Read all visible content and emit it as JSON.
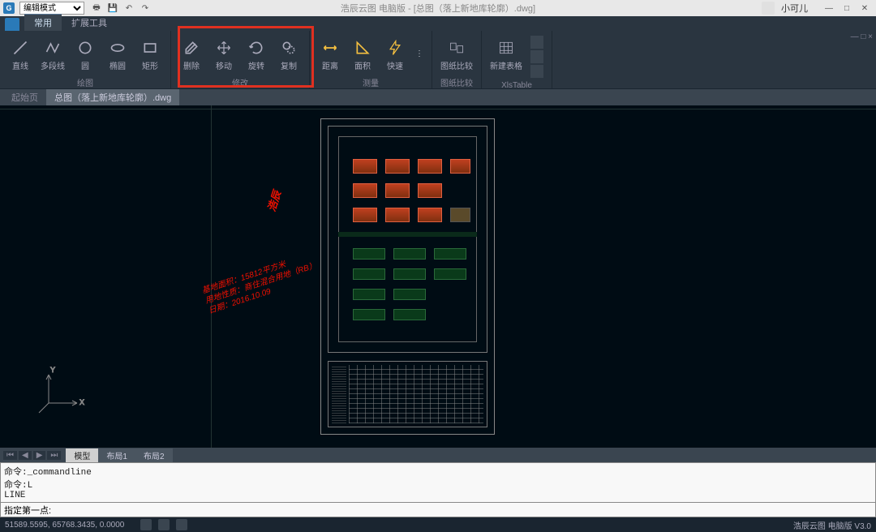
{
  "titlebar": {
    "mode": "编辑模式",
    "title": "浩辰云图 电脑版 - [总图（落上新地库轮廓）.dwg]",
    "user": "小可儿"
  },
  "menu": {
    "tabs": [
      "常用",
      "扩展工具"
    ],
    "active": 0
  },
  "ribbon": {
    "groups": [
      {
        "label": "绘图",
        "items": [
          {
            "name": "line",
            "label": "直线"
          },
          {
            "name": "polyline",
            "label": "多段线"
          },
          {
            "name": "circle",
            "label": "圆"
          },
          {
            "name": "ellipse",
            "label": "椭圆"
          },
          {
            "name": "rect",
            "label": "矩形"
          }
        ]
      },
      {
        "label": "修改",
        "items": [
          {
            "name": "erase",
            "label": "删除"
          },
          {
            "name": "move",
            "label": "移动"
          },
          {
            "name": "rotate",
            "label": "旋转"
          },
          {
            "name": "copy",
            "label": "复制"
          }
        ]
      },
      {
        "label": "测量",
        "items": [
          {
            "name": "dist",
            "label": "距离"
          },
          {
            "name": "area",
            "label": "面积"
          },
          {
            "name": "quick",
            "label": "快速"
          }
        ]
      },
      {
        "label": "图纸比较",
        "items": [
          {
            "name": "compare",
            "label": "图纸比较"
          }
        ]
      },
      {
        "label": "XlsTable",
        "items": [
          {
            "name": "newtable",
            "label": "新建表格"
          }
        ]
      }
    ]
  },
  "docTabs": {
    "start": "起始页",
    "tabs": [
      "总图（落上新地库轮廓）.dwg"
    ],
    "active": 0
  },
  "annotations": {
    "title": "浩辰",
    "lines": "基地面积：15812平方米\n用地性质：商住混合用地（RB）\n日期：2016.10.09"
  },
  "viewTabs": {
    "tabs": [
      "模型",
      "布局1",
      "布局2"
    ],
    "active": 0
  },
  "command": {
    "history": "命令:_commandline\n命令:L\nLINE",
    "prompt": "指定第一点:"
  },
  "status": {
    "coords": "51589.5595, 65768.3435, 0.0000",
    "version": "浩辰云图 电脑版 V3.0"
  }
}
